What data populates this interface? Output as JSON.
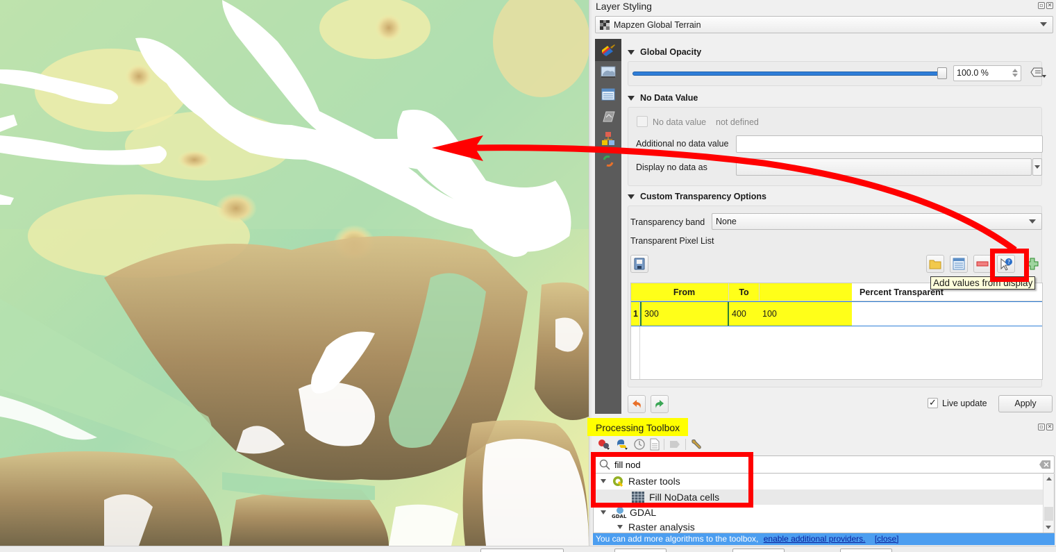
{
  "layer_styling": {
    "title": "Layer Styling",
    "layer_name": "Mapzen Global Terrain",
    "tabs": [
      {
        "name": "symbology",
        "icon": "paintbrush-icon",
        "active": true
      },
      {
        "name": "transparency",
        "icon": "raster-transparency-icon",
        "active": false
      },
      {
        "name": "histogram",
        "icon": "histogram-table-icon",
        "active": false
      },
      {
        "name": "rendering",
        "icon": "rendering-icon",
        "active": false
      },
      {
        "name": "pyramids",
        "icon": "pyramids-icon",
        "active": false
      },
      {
        "name": "history",
        "icon": "history-icon",
        "active": false
      }
    ],
    "global_opacity": {
      "title": "Global Opacity",
      "value_fraction": 1.0,
      "value_text": "100.0 %"
    },
    "no_data": {
      "title": "No Data Value",
      "checkbox_label": "No data value",
      "checkbox_value": "not defined",
      "checked": false,
      "additional_label": "Additional no data value",
      "additional_value": "",
      "display_label": "Display no data as"
    },
    "custom_transparency": {
      "title": "Custom Transparency Options",
      "band_label": "Transparency band",
      "band_value": "None",
      "pixel_list_label": "Transparent Pixel List",
      "tooltip": "Add values from display",
      "columns": [
        "From",
        "To",
        "Percent Transparent"
      ],
      "rows": [
        {
          "index": "1",
          "from": "300",
          "to": "400",
          "percent": "100"
        }
      ]
    },
    "live_update_label": "Live update",
    "live_update_checked": true,
    "apply_label": "Apply"
  },
  "processing_toolbox": {
    "title": "Processing Toolbox",
    "search_value": "fill nod",
    "tree": [
      {
        "label": "Raster tools",
        "level": 0,
        "expanded": true,
        "icon": "qgis-icon"
      },
      {
        "label": "Fill NoData cells",
        "level": 1,
        "selected": true,
        "icon": "raster-grid-icon"
      },
      {
        "label": "GDAL",
        "level": 0,
        "expanded": true,
        "icon": "gdal-icon"
      },
      {
        "label": "Raster analysis",
        "level": 1,
        "expanded": true
      }
    ],
    "info_text": "You can add more algorithms to the toolbox,",
    "info_link": "enable additional providers.",
    "info_close": "[close]"
  },
  "colors": {
    "accent": "#2f7ed8",
    "annotation_red": "#ff0000",
    "highlight_yellow": "#ffff00",
    "info_bar": "#4c9ef0"
  }
}
